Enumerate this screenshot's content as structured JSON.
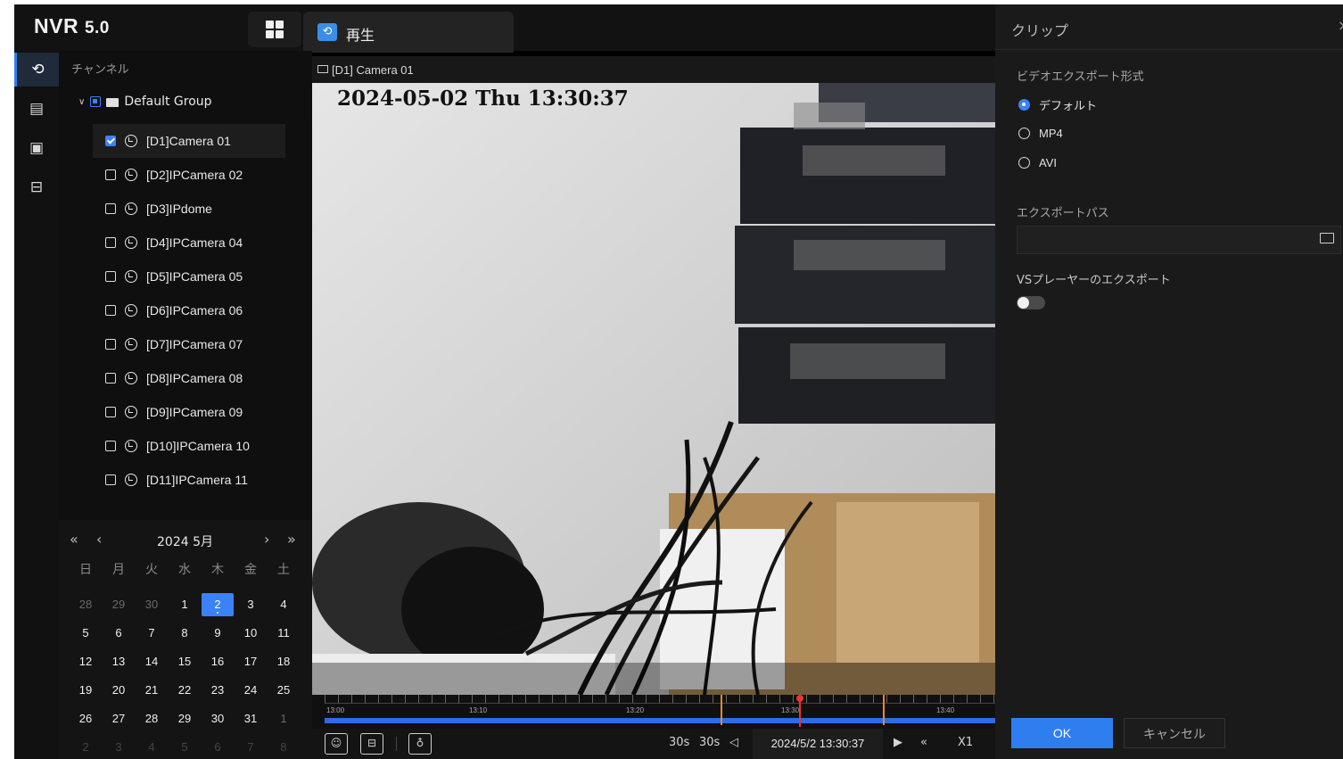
{
  "app": {
    "logo_main": "NVR",
    "logo_ver": "5.0"
  },
  "tab": {
    "label": "再生"
  },
  "channels": {
    "title": "チャンネル",
    "group": "Default Group",
    "items": [
      {
        "label": "[D1]Camera 01",
        "checked": true
      },
      {
        "label": "[D2]IPCamera 02",
        "checked": false
      },
      {
        "label": "[D3]IPdome",
        "checked": false
      },
      {
        "label": "[D4]IPCamera 04",
        "checked": false
      },
      {
        "label": "[D5]IPCamera 05",
        "checked": false
      },
      {
        "label": "[D6]IPCamera 06",
        "checked": false
      },
      {
        "label": "[D7]IPCamera 07",
        "checked": false
      },
      {
        "label": "[D8]IPCamera 08",
        "checked": false
      },
      {
        "label": "[D9]IPCamera 09",
        "checked": false
      },
      {
        "label": "[D10]IPCamera 10",
        "checked": false
      },
      {
        "label": "[D11]IPCamera 11",
        "checked": false
      }
    ]
  },
  "calendar": {
    "title": "2024 5月",
    "weekdays": [
      "日",
      "月",
      "火",
      "水",
      "木",
      "金",
      "土"
    ],
    "weeks": [
      [
        "28",
        "29",
        "30",
        "1",
        "2",
        "3",
        "4"
      ],
      [
        "5",
        "6",
        "7",
        "8",
        "9",
        "10",
        "11"
      ],
      [
        "12",
        "13",
        "14",
        "15",
        "16",
        "17",
        "18"
      ],
      [
        "19",
        "20",
        "21",
        "22",
        "23",
        "24",
        "25"
      ],
      [
        "26",
        "27",
        "28",
        "29",
        "30",
        "31",
        "1"
      ],
      [
        "2",
        "3",
        "4",
        "5",
        "6",
        "7",
        "8"
      ]
    ],
    "selected": "2"
  },
  "video": {
    "channel_label": "[D1] Camera 01",
    "osd_timestamp": "2024-05-02 Thu 13:30:37"
  },
  "timeline": {
    "labels": [
      "13:00",
      "13:10",
      "13:20",
      "13:30",
      "13:40"
    ]
  },
  "controls": {
    "skip_back": "30s",
    "skip_fwd": "30s",
    "time_readout": "2024/5/2 13:30:37",
    "speed": "X1"
  },
  "clip": {
    "title": "クリップ",
    "format_label": "ビデオエクスポート形式",
    "formats": [
      "デフォルト",
      "MP4",
      "AVI"
    ],
    "selected_format": "デフォルト",
    "path_label": "エクスポートパス",
    "path_value": "",
    "vs_label": "VSプレーヤーのエクスポート",
    "vs_enabled": false,
    "ok": "OK",
    "cancel": "キャンセル"
  },
  "colors": {
    "accent": "#2f7ef0",
    "timeline_bar": "#2f6ae8",
    "marker": "#e8892b",
    "cursor": "#e33333"
  }
}
